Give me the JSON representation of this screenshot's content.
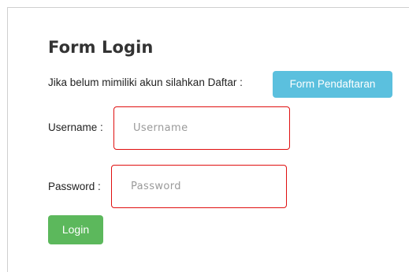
{
  "form": {
    "title": "Form Login",
    "register_prompt": "Jika belum mimiliki akun silahkan Daftar :",
    "register_button_label": "Form Pendaftaran",
    "username_label": "Username :",
    "username_value": "",
    "username_placeholder": "Username",
    "password_label": "Password :",
    "password_value": "",
    "password_placeholder": "Password",
    "login_button_label": "Login"
  },
  "colors": {
    "info_button": "#5bc0de",
    "success_button": "#5cb85c",
    "input_border_error": "#e01010",
    "text": "#222222"
  }
}
